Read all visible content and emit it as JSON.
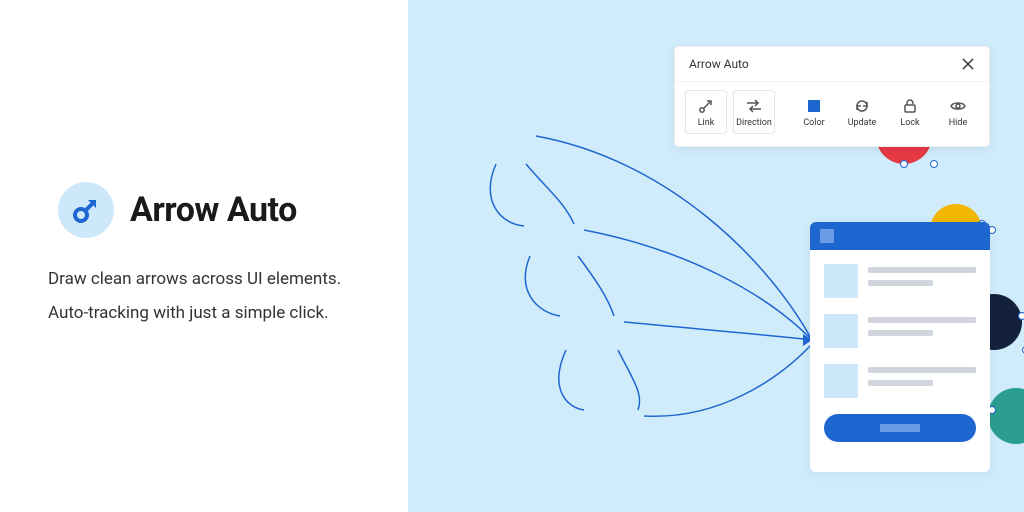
{
  "brand": {
    "title": "Arrow Auto",
    "desc_line1": "Draw clean arrows across UI elements.",
    "desc_line2": "Auto-tracking with just a simple click."
  },
  "panel": {
    "title": "Arrow Auto",
    "tools": {
      "link": "Link",
      "direction": "Direction",
      "color": "Color",
      "update": "Update",
      "lock": "Lock",
      "hide": "Hide"
    }
  },
  "colors": {
    "accent": "#1e66d0",
    "canvas": "#d0ecfb",
    "nodes": {
      "red": "#e63946",
      "yellow": "#f2b705",
      "navy": "#14213d",
      "teal": "#2a9d8f"
    }
  }
}
